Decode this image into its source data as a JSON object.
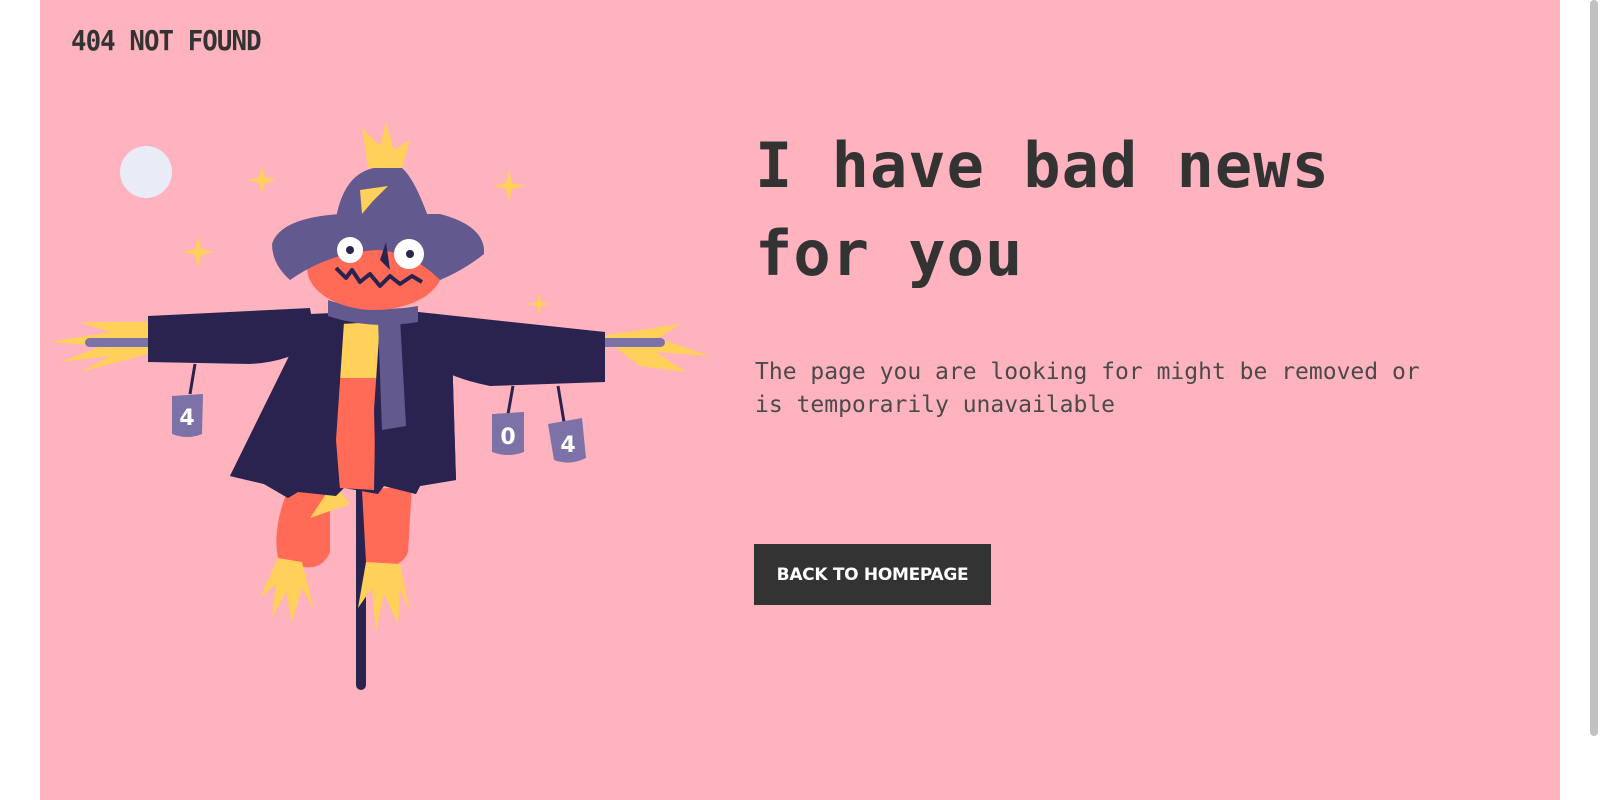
{
  "brand": {
    "label": "404 NOT FOUND"
  },
  "main": {
    "headline": "I have bad news for you",
    "message": "The page you are looking for might be removed or is temporarily unavailable",
    "back_button": "BACK TO HOMEPAGE"
  },
  "illustration": {
    "cans": [
      "4",
      "0",
      "4"
    ]
  },
  "colors": {
    "background": "#ffb3bf",
    "text": "#333333",
    "button": "#333333",
    "button_text": "#ffffff",
    "coat": "#2a2350",
    "hat": "#625a8f",
    "face": "#ff6b57",
    "straw": "#ffd05a"
  }
}
